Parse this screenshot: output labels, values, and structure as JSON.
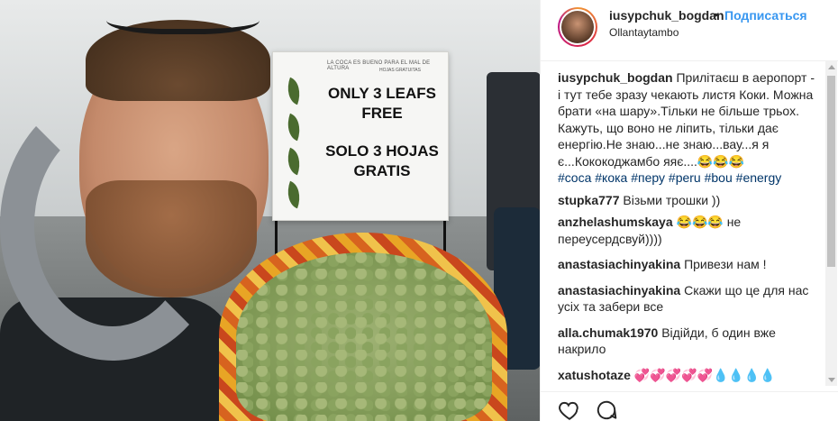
{
  "header": {
    "username": "iusypchuk_bogdan",
    "separator": "•",
    "follow_label": "Подписаться",
    "location": "Ollantaytambo"
  },
  "sign": {
    "small_text": "LA COCA ES BUENO PARA EL MAL DE ALTURA",
    "small_text2": "HOJAS GRATUITAS",
    "line1": "ONLY 3 LEAFS",
    "line2": "FREE",
    "line3": "SOLO 3 HOJAS",
    "line4": "GRATIS"
  },
  "caption": {
    "username": "iusypchuk_bogdan",
    "text1": "Прилітаєш в аеропорт - і тут тебе зразу чекають листя Коки. Можна брати «на шару».Тільки не більше трьох.",
    "text2": "Кажуть, що воно не ліпить, тільки дає енергію.Не знаю...не знаю...вау...я я є...Кококоджамбо яяє....😂😂😂",
    "tags": [
      "#coca",
      "#кока",
      "#перу",
      "#peru",
      "#bou",
      "#energy"
    ]
  },
  "comments": [
    {
      "user": "stupka777",
      "text": "Візьми трошки ))"
    },
    {
      "user": "anzhelashumskaya",
      "text": "😂😂😂 не переусердсвуй))))"
    },
    {
      "user": "anastasiachinyakina",
      "text": "Привези нам !"
    },
    {
      "user": "anastasiachinyakina",
      "text": "Скажи що це для нас усіх та забери все"
    },
    {
      "user": "alla.chumak1970",
      "text": "Відійди, б один вже накрило"
    },
    {
      "user": "xatushotaze",
      "text": "💞💞💞💞💞💧💧💧💧"
    }
  ],
  "icons": {
    "like": "heart-icon",
    "comment": "comment-icon"
  }
}
